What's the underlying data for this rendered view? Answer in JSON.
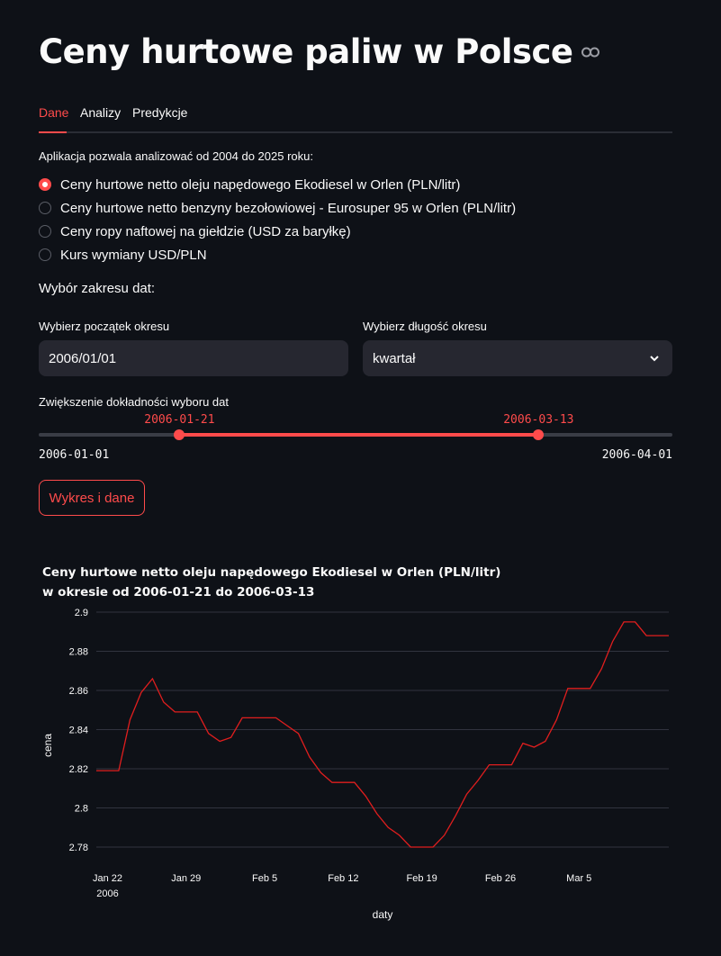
{
  "header": {
    "title": "Ceny hurtowe paliw w Polsce",
    "link_icon": "link-icon"
  },
  "tabs": [
    {
      "label": "Dane",
      "active": true
    },
    {
      "label": "Analizy",
      "active": false
    },
    {
      "label": "Predykcje",
      "active": false
    }
  ],
  "intro": "Aplikacja pozwala analizować od 2004 do 2025 roku:",
  "radio_options": [
    {
      "label": "Ceny hurtowe netto oleju napędowego Ekodiesel w Orlen (PLN/litr)",
      "checked": true
    },
    {
      "label": "Ceny hurtowe netto benzyny bezołowiowej - Eurosuper 95 w Orlen (PLN/litr)",
      "checked": false
    },
    {
      "label": "Ceny ropy naftowej na giełdzie (USD za baryłkę)",
      "checked": false
    },
    {
      "label": "Kurs wymiany USD/PLN",
      "checked": false
    }
  ],
  "range_section": {
    "label": "Wybór zakresu dat:",
    "start_label": "Wybierz początek okresu",
    "start_value": "2006/01/01",
    "length_label": "Wybierz długość okresu",
    "length_value": "kwartał"
  },
  "slider": {
    "label": "Zwiększenie dokładności wyboru dat",
    "min": "2006-01-01",
    "max": "2006-04-01",
    "low": "2006-01-21",
    "high": "2006-03-13",
    "low_fraction": 0.2222,
    "high_fraction": 0.7889
  },
  "button": {
    "label": "Wykres i dane"
  },
  "colors": {
    "accent": "#ff4b4b",
    "line": "#e01e1e",
    "background": "#0e1117",
    "input": "#262730"
  },
  "chart_data": {
    "type": "line",
    "title_line1": "Ceny hurtowe netto oleju napędowego Ekodiesel w Orlen (PLN/litr)",
    "title_line2": "w okresie od 2006-01-21 do 2006-03-13",
    "xlabel": "daty",
    "ylabel": "cena",
    "x_start": "2006-01-21",
    "x_end": "2006-03-13",
    "ylim": [
      2.774,
      2.9
    ],
    "yticks": [
      2.78,
      2.8,
      2.82,
      2.84,
      2.86,
      2.88,
      2.9
    ],
    "xticks": [
      {
        "date": "2006-01-22",
        "label": "Jan 22",
        "sublabel": "2006"
      },
      {
        "date": "2006-01-29",
        "label": "Jan 29",
        "sublabel": ""
      },
      {
        "date": "2006-02-05",
        "label": "Feb 5",
        "sublabel": ""
      },
      {
        "date": "2006-02-12",
        "label": "Feb 12",
        "sublabel": ""
      },
      {
        "date": "2006-02-19",
        "label": "Feb 19",
        "sublabel": ""
      },
      {
        "date": "2006-02-26",
        "label": "Feb 26",
        "sublabel": ""
      },
      {
        "date": "2006-03-05",
        "label": "Mar 5",
        "sublabel": ""
      }
    ],
    "grid": true,
    "points": [
      [
        "2006-01-21",
        2.819
      ],
      [
        "2006-01-22",
        2.819
      ],
      [
        "2006-01-23",
        2.819
      ],
      [
        "2006-01-24",
        2.845
      ],
      [
        "2006-01-25",
        2.859
      ],
      [
        "2006-01-26",
        2.866
      ],
      [
        "2006-01-27",
        2.854
      ],
      [
        "2006-01-28",
        2.849
      ],
      [
        "2006-01-29",
        2.849
      ],
      [
        "2006-01-30",
        2.849
      ],
      [
        "2006-01-31",
        2.838
      ],
      [
        "2006-02-01",
        2.834
      ],
      [
        "2006-02-02",
        2.836
      ],
      [
        "2006-02-03",
        2.846
      ],
      [
        "2006-02-04",
        2.846
      ],
      [
        "2006-02-05",
        2.846
      ],
      [
        "2006-02-06",
        2.846
      ],
      [
        "2006-02-07",
        2.842
      ],
      [
        "2006-02-08",
        2.838
      ],
      [
        "2006-02-09",
        2.826
      ],
      [
        "2006-02-10",
        2.818
      ],
      [
        "2006-02-11",
        2.813
      ],
      [
        "2006-02-12",
        2.813
      ],
      [
        "2006-02-13",
        2.813
      ],
      [
        "2006-02-14",
        2.806
      ],
      [
        "2006-02-15",
        2.797
      ],
      [
        "2006-02-16",
        2.79
      ],
      [
        "2006-02-17",
        2.786
      ],
      [
        "2006-02-18",
        2.78
      ],
      [
        "2006-02-19",
        2.78
      ],
      [
        "2006-02-20",
        2.78
      ],
      [
        "2006-02-21",
        2.786
      ],
      [
        "2006-02-22",
        2.796
      ],
      [
        "2006-02-23",
        2.807
      ],
      [
        "2006-02-24",
        2.814
      ],
      [
        "2006-02-25",
        2.822
      ],
      [
        "2006-02-26",
        2.822
      ],
      [
        "2006-02-27",
        2.822
      ],
      [
        "2006-02-28",
        2.833
      ],
      [
        "2006-03-01",
        2.831
      ],
      [
        "2006-03-02",
        2.834
      ],
      [
        "2006-03-03",
        2.845
      ],
      [
        "2006-03-04",
        2.861
      ],
      [
        "2006-03-05",
        2.861
      ],
      [
        "2006-03-06",
        2.861
      ],
      [
        "2006-03-07",
        2.871
      ],
      [
        "2006-03-08",
        2.885
      ],
      [
        "2006-03-09",
        2.895
      ],
      [
        "2006-03-10",
        2.895
      ],
      [
        "2006-03-11",
        2.888
      ],
      [
        "2006-03-12",
        2.888
      ],
      [
        "2006-03-13",
        2.888
      ]
    ]
  }
}
